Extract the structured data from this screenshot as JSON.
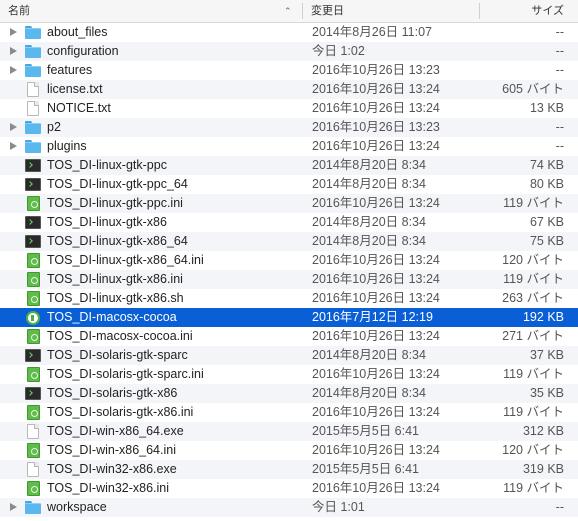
{
  "columns": {
    "name": "名前",
    "modified": "変更日",
    "size": "サイズ",
    "sort_indicator": "⌃"
  },
  "files": [
    {
      "name": "about_files",
      "date": "2014年8月26日 11:07",
      "size": "--",
      "kind": "folder",
      "selected": false
    },
    {
      "name": "configuration",
      "date": "今日 1:02",
      "size": "--",
      "kind": "folder",
      "selected": false
    },
    {
      "name": "features",
      "date": "2016年10月26日 13:23",
      "size": "--",
      "kind": "folder",
      "selected": false
    },
    {
      "name": "license.txt",
      "date": "2016年10月26日 13:24",
      "size": "605 バイト",
      "kind": "document",
      "selected": false
    },
    {
      "name": "NOTICE.txt",
      "date": "2016年10月26日 13:24",
      "size": "13 KB",
      "kind": "document",
      "selected": false
    },
    {
      "name": "p2",
      "date": "2016年10月26日 13:23",
      "size": "--",
      "kind": "folder",
      "selected": false
    },
    {
      "name": "plugins",
      "date": "2016年10月26日 13:24",
      "size": "--",
      "kind": "folder",
      "selected": false
    },
    {
      "name": "TOS_DI-linux-gtk-ppc",
      "date": "2014年8月20日 8:34",
      "size": "74 KB",
      "kind": "executable",
      "selected": false
    },
    {
      "name": "TOS_DI-linux-gtk-ppc_64",
      "date": "2014年8月20日 8:34",
      "size": "80 KB",
      "kind": "executable",
      "selected": false
    },
    {
      "name": "TOS_DI-linux-gtk-ppc.ini",
      "date": "2016年10月26日 13:24",
      "size": "119 バイト",
      "kind": "ini",
      "selected": false
    },
    {
      "name": "TOS_DI-linux-gtk-x86",
      "date": "2014年8月20日 8:34",
      "size": "67 KB",
      "kind": "executable",
      "selected": false
    },
    {
      "name": "TOS_DI-linux-gtk-x86_64",
      "date": "2014年8月20日 8:34",
      "size": "75 KB",
      "kind": "executable",
      "selected": false
    },
    {
      "name": "TOS_DI-linux-gtk-x86_64.ini",
      "date": "2016年10月26日 13:24",
      "size": "120 バイト",
      "kind": "ini",
      "selected": false
    },
    {
      "name": "TOS_DI-linux-gtk-x86.ini",
      "date": "2016年10月26日 13:24",
      "size": "119 バイト",
      "kind": "ini",
      "selected": false
    },
    {
      "name": "TOS_DI-linux-gtk-x86.sh",
      "date": "2016年10月26日 13:24",
      "size": "263 バイト",
      "kind": "ini",
      "selected": false
    },
    {
      "name": "TOS_DI-macosx-cocoa",
      "date": "2016年7月12日 12:19",
      "size": "192 KB",
      "kind": "app",
      "selected": true
    },
    {
      "name": "TOS_DI-macosx-cocoa.ini",
      "date": "2016年10月26日 13:24",
      "size": "271 バイト",
      "kind": "ini",
      "selected": false
    },
    {
      "name": "TOS_DI-solaris-gtk-sparc",
      "date": "2014年8月20日 8:34",
      "size": "37 KB",
      "kind": "executable",
      "selected": false
    },
    {
      "name": "TOS_DI-solaris-gtk-sparc.ini",
      "date": "2016年10月26日 13:24",
      "size": "119 バイト",
      "kind": "ini",
      "selected": false
    },
    {
      "name": "TOS_DI-solaris-gtk-x86",
      "date": "2014年8月20日 8:34",
      "size": "35 KB",
      "kind": "executable",
      "selected": false
    },
    {
      "name": "TOS_DI-solaris-gtk-x86.ini",
      "date": "2016年10月26日 13:24",
      "size": "119 バイト",
      "kind": "ini",
      "selected": false
    },
    {
      "name": "TOS_DI-win-x86_64.exe",
      "date": "2015年5月5日 6:41",
      "size": "312 KB",
      "kind": "document",
      "selected": false
    },
    {
      "name": "TOS_DI-win-x86_64.ini",
      "date": "2016年10月26日 13:24",
      "size": "120 バイト",
      "kind": "ini",
      "selected": false
    },
    {
      "name": "TOS_DI-win32-x86.exe",
      "date": "2015年5月5日 6:41",
      "size": "319 KB",
      "kind": "document",
      "selected": false
    },
    {
      "name": "TOS_DI-win32-x86.ini",
      "date": "2016年10月26日 13:24",
      "size": "119 バイト",
      "kind": "ini",
      "selected": false
    },
    {
      "name": "workspace",
      "date": "今日 1:01",
      "size": "--",
      "kind": "folder",
      "selected": false
    }
  ],
  "icon_names": {
    "folder": "folder-icon",
    "document": "document-icon",
    "executable": "terminal-executable-icon",
    "ini": "config-file-icon",
    "app": "application-icon"
  },
  "colors": {
    "selection": "#0a5fd6",
    "folder": "#5bb8ef",
    "stripe": "#f3f5f8"
  }
}
